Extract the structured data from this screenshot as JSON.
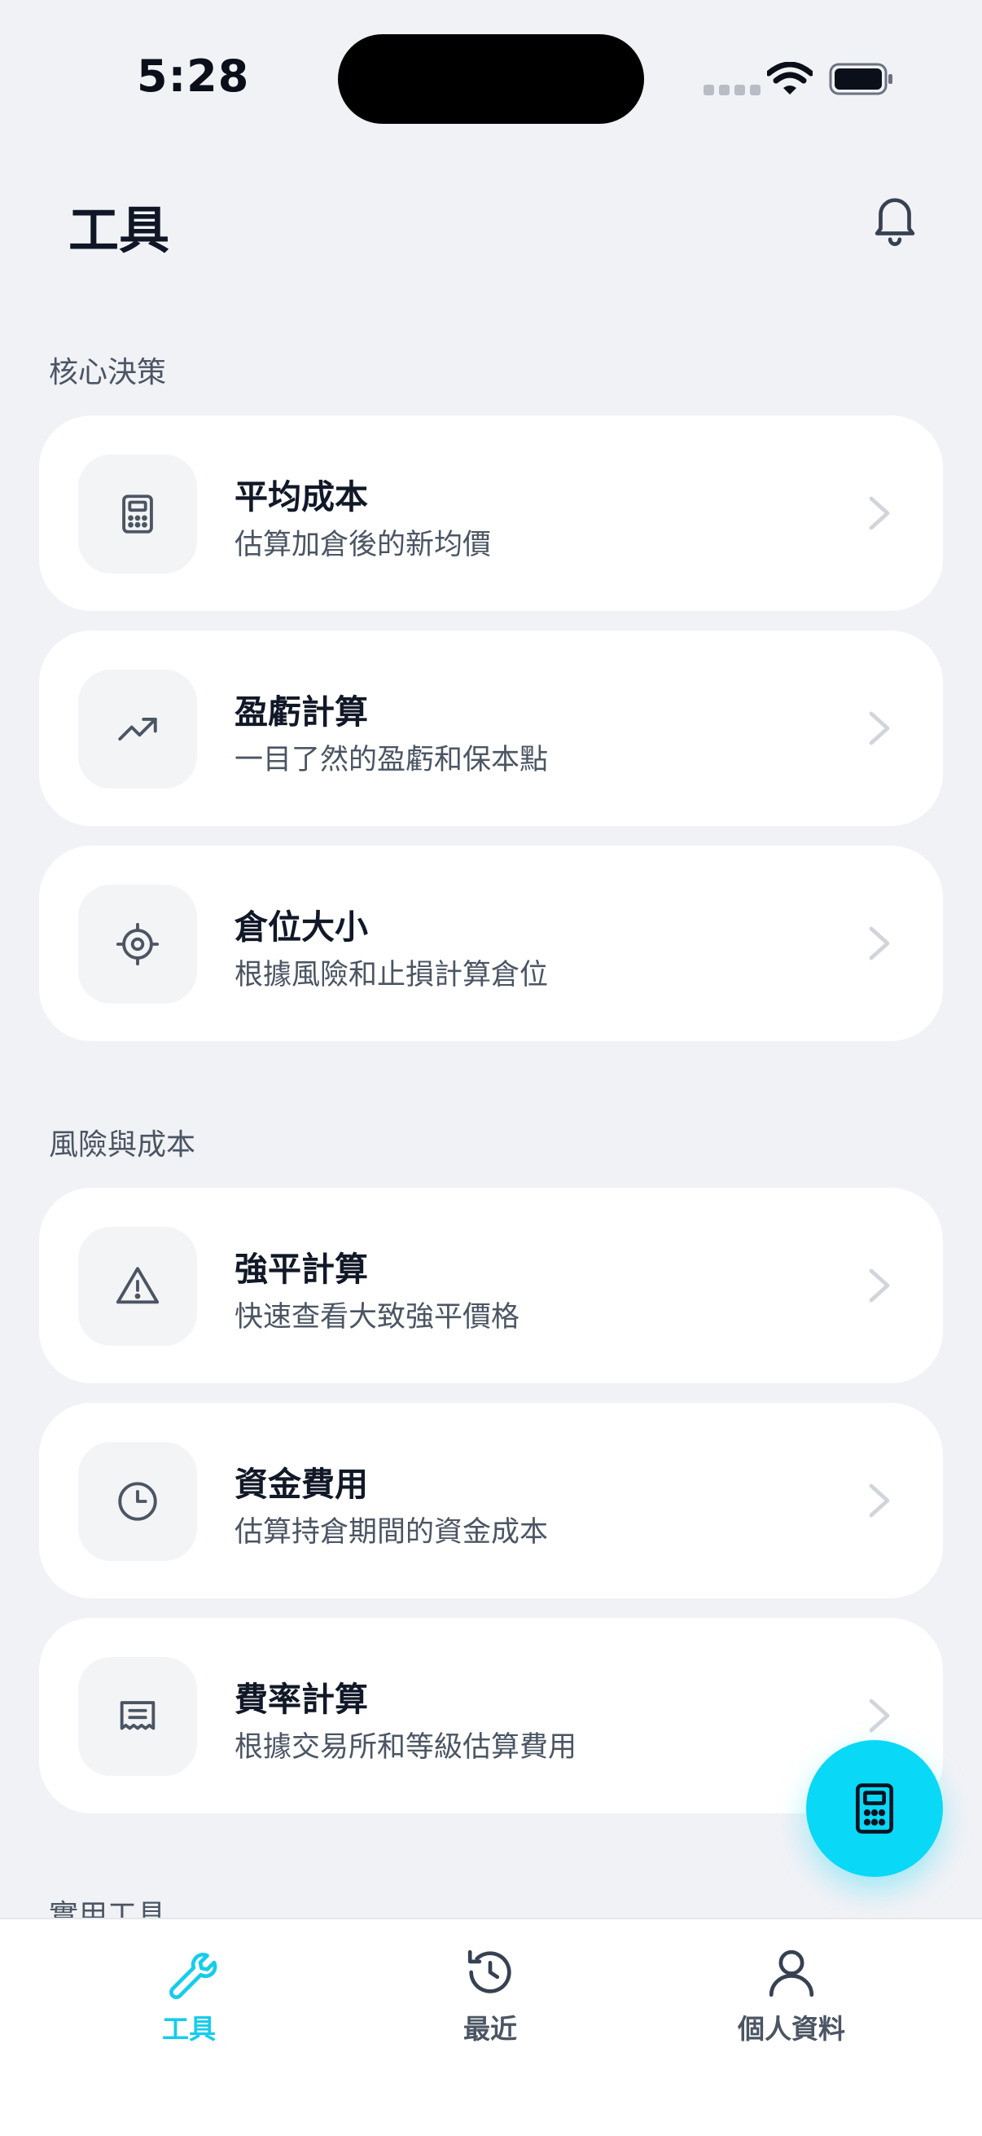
{
  "status_bar": {
    "time": "5:28"
  },
  "header": {
    "title": "工具"
  },
  "sections": [
    {
      "title": "核心決策",
      "cards": [
        {
          "title": "平均成本",
          "subtitle": "估算加倉後的新均價",
          "icon": "calculator-icon"
        },
        {
          "title": "盈虧計算",
          "subtitle": "一目了然的盈虧和保本點",
          "icon": "trending-up-icon"
        },
        {
          "title": "倉位大小",
          "subtitle": "根據風險和止損計算倉位",
          "icon": "crosshair-icon"
        }
      ]
    },
    {
      "title": "風險與成本",
      "cards": [
        {
          "title": "強平計算",
          "subtitle": "快速查看大致強平價格",
          "icon": "warning-icon"
        },
        {
          "title": "資金費用",
          "subtitle": "估算持倉期間的資金成本",
          "icon": "clock-icon"
        },
        {
          "title": "費率計算",
          "subtitle": "根據交易所和等級估算費用",
          "icon": "receipt-icon"
        }
      ]
    },
    {
      "title": "實用工具"
    }
  ],
  "fab": {
    "icon": "calculator-icon"
  },
  "bottom_nav": {
    "items": [
      {
        "label": "工具",
        "icon": "wrench-icon",
        "active": true
      },
      {
        "label": "最近",
        "icon": "history-icon",
        "active": false
      },
      {
        "label": "個人資料",
        "icon": "user-icon",
        "active": false
      }
    ]
  },
  "colors": {
    "accent": "#09d8f7",
    "background": "#f1f2f6",
    "card": "#ffffff",
    "text": "#111827",
    "muted": "#4b5563"
  }
}
